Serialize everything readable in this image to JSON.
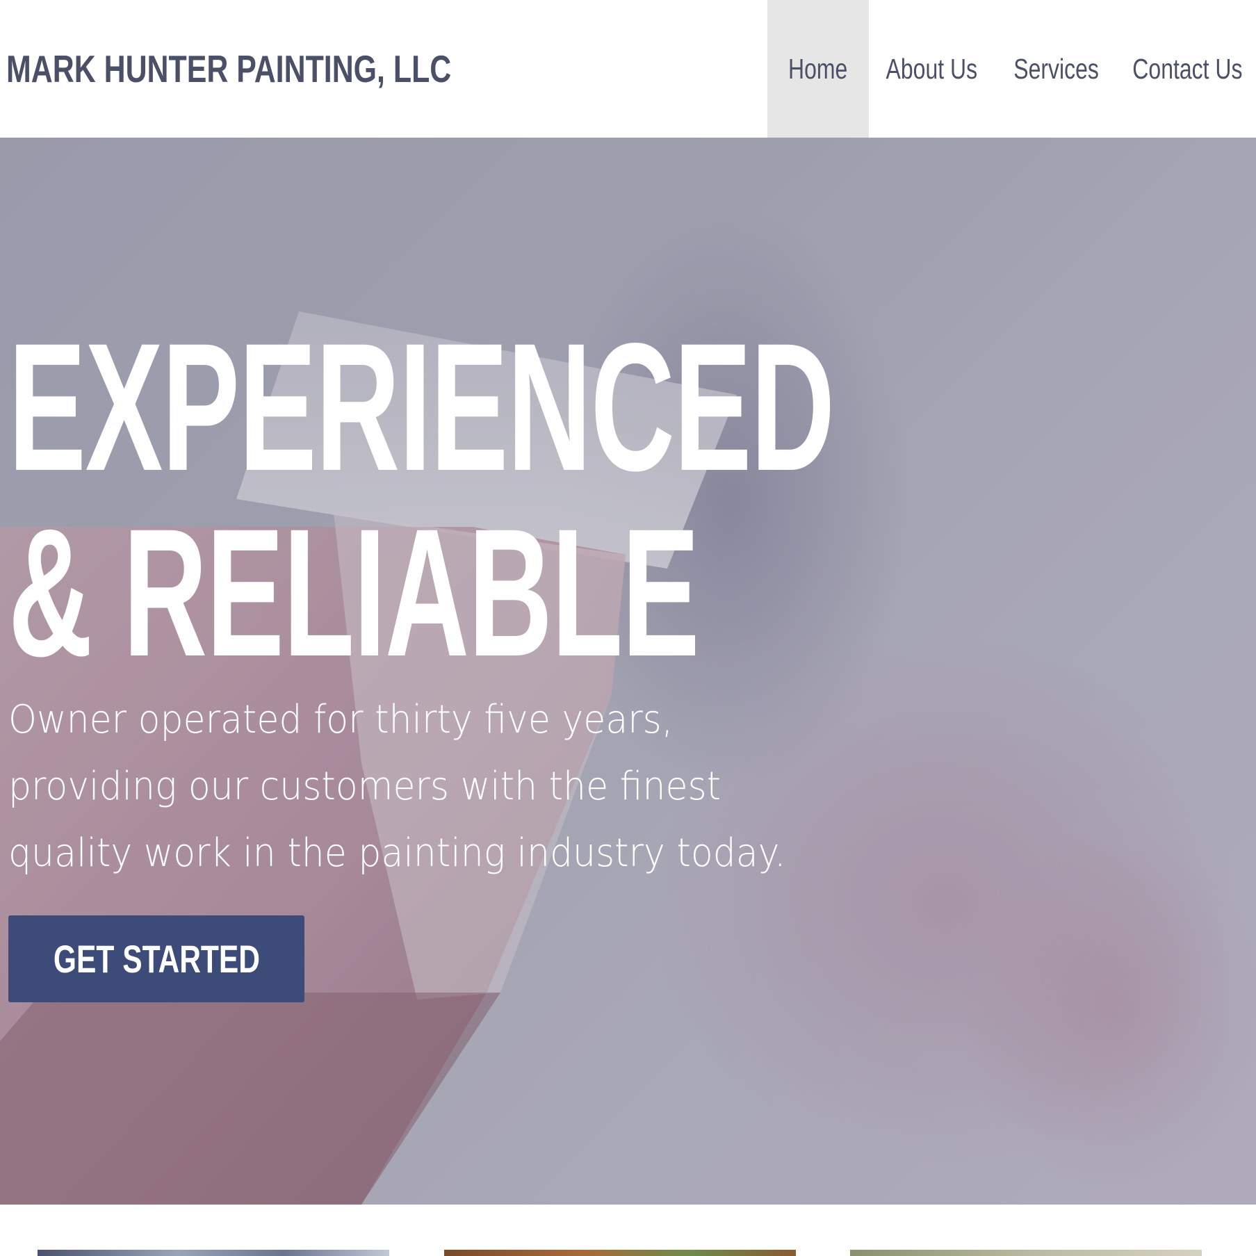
{
  "header": {
    "brand": "MARK HUNTER PAINTING, LLC",
    "nav": [
      {
        "label": "Home",
        "active": true
      },
      {
        "label": "About Us",
        "active": false
      },
      {
        "label": "Services",
        "active": false
      },
      {
        "label": "Contact Us",
        "active": false
      }
    ]
  },
  "hero": {
    "headline_line1": "EXPERIENCED",
    "headline_line2": "& RELIABLE",
    "subtext_lines": [
      "Owner operated for thirty five years,",
      "providing our customers with the finest",
      "quality work in the painting industry today."
    ],
    "cta_label": "GET STARTED",
    "background_image": "paintbrush-on-wall"
  },
  "thumbnails": [
    {
      "image": "thumbnail-1"
    },
    {
      "image": "thumbnail-2"
    },
    {
      "image": "thumbnail-3"
    }
  ],
  "colors": {
    "brand_text": "#4a5068",
    "nav_active_bg": "#e6e6e6",
    "cta_bg": "#3d4b78",
    "hero_text": "#ffffff"
  }
}
